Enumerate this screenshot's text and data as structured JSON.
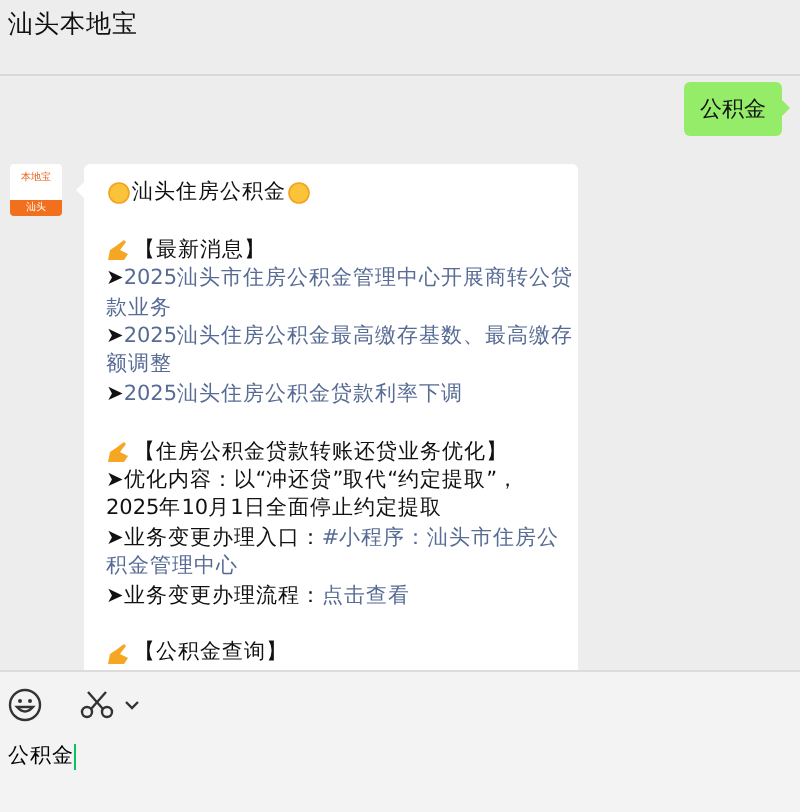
{
  "window": {
    "title": "汕头本地宝"
  },
  "messages": [
    {
      "kind": "sent",
      "text": "公积金"
    },
    {
      "kind": "received",
      "avatar": {
        "top": "本地宝",
        "bottom": "汕头"
      },
      "title": "汕头住房公积金",
      "sections": [
        {
          "heading": "【最新消息】",
          "lines": [
            [
              {
                "kind": "text",
                "text": "➤"
              },
              {
                "kind": "link",
                "text": "2025汕头市住房公积金管理中心开展商转公贷"
              }
            ],
            [
              {
                "kind": "link",
                "text": "款业务"
              }
            ],
            [
              {
                "kind": "text",
                "text": "➤"
              },
              {
                "kind": "link",
                "text": "2025汕头住房公积金最高缴存基数、最高缴存"
              }
            ],
            [
              {
                "kind": "link",
                "text": "额调整"
              }
            ],
            [
              {
                "kind": "text",
                "text": "➤"
              },
              {
                "kind": "link",
                "text": "2025汕头住房公积金贷款利率下调"
              }
            ]
          ]
        },
        {
          "heading": "【住房公积金贷款转账还贷业务优化】",
          "lines": [
            [
              {
                "kind": "text",
                "text": "➤优化内容：以“冲还贷”取代“约定提取”，"
              }
            ],
            [
              {
                "kind": "text",
                "text": "2025年10月1日全面停止约定提取"
              }
            ],
            [
              {
                "kind": "text",
                "text": "➤业务变更办理入口："
              },
              {
                "kind": "link",
                "text": "#小程序：汕头市住房公"
              }
            ],
            [
              {
                "kind": "link",
                "text": "积金管理中心"
              }
            ],
            [
              {
                "kind": "text",
                "text": "➤业务变更办理流程："
              },
              {
                "kind": "link",
                "text": "点击查看"
              }
            ]
          ]
        },
        {
          "heading": "【公积金查询】"
        }
      ]
    }
  ],
  "composer": {
    "value": "公积金"
  }
}
